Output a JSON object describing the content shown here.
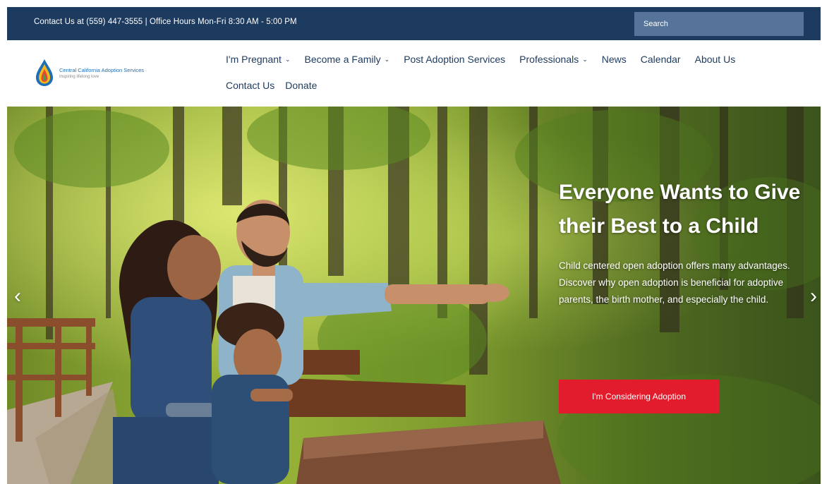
{
  "topbar": {
    "contact_text": "Contact Us at (559) 447-3555 | Office Hours Mon-Fri 8:30 AM - 5:00 PM",
    "search_placeholder": "Search"
  },
  "logo": {
    "name": "Central California Adoption Services",
    "tagline": "Inspiring lifelong love"
  },
  "nav": {
    "items": [
      {
        "label": "I'm Pregnant",
        "dropdown": true
      },
      {
        "label": "Become a Family",
        "dropdown": true
      },
      {
        "label": "Post Adoption Services",
        "dropdown": false
      },
      {
        "label": "Professionals",
        "dropdown": true
      },
      {
        "label": "News",
        "dropdown": false
      },
      {
        "label": "Calendar",
        "dropdown": false
      },
      {
        "label": "About Us",
        "dropdown": false
      },
      {
        "label": "Contact Us",
        "dropdown": false
      },
      {
        "label": "Donate",
        "dropdown": false
      }
    ],
    "caret_glyph": "⌄"
  },
  "hero": {
    "title": "Everyone Wants to Give their Best to a Child",
    "body": "Child centered open adoption offers many advantages. Discover why open adoption is beneficial for adoptive parents, the birth mother, and especially the child.",
    "cta_label": "I'm Considering Adoption",
    "prev_glyph": "‹",
    "next_glyph": "›"
  },
  "colors": {
    "navy": "#1d3a5f",
    "search_bg": "#56739a",
    "cta_red": "#e31c2d",
    "white": "#ffffff"
  },
  "icons": [
    "chevron-down-icon",
    "arrow-left-icon",
    "arrow-right-icon",
    "logo-drop-icon"
  ]
}
